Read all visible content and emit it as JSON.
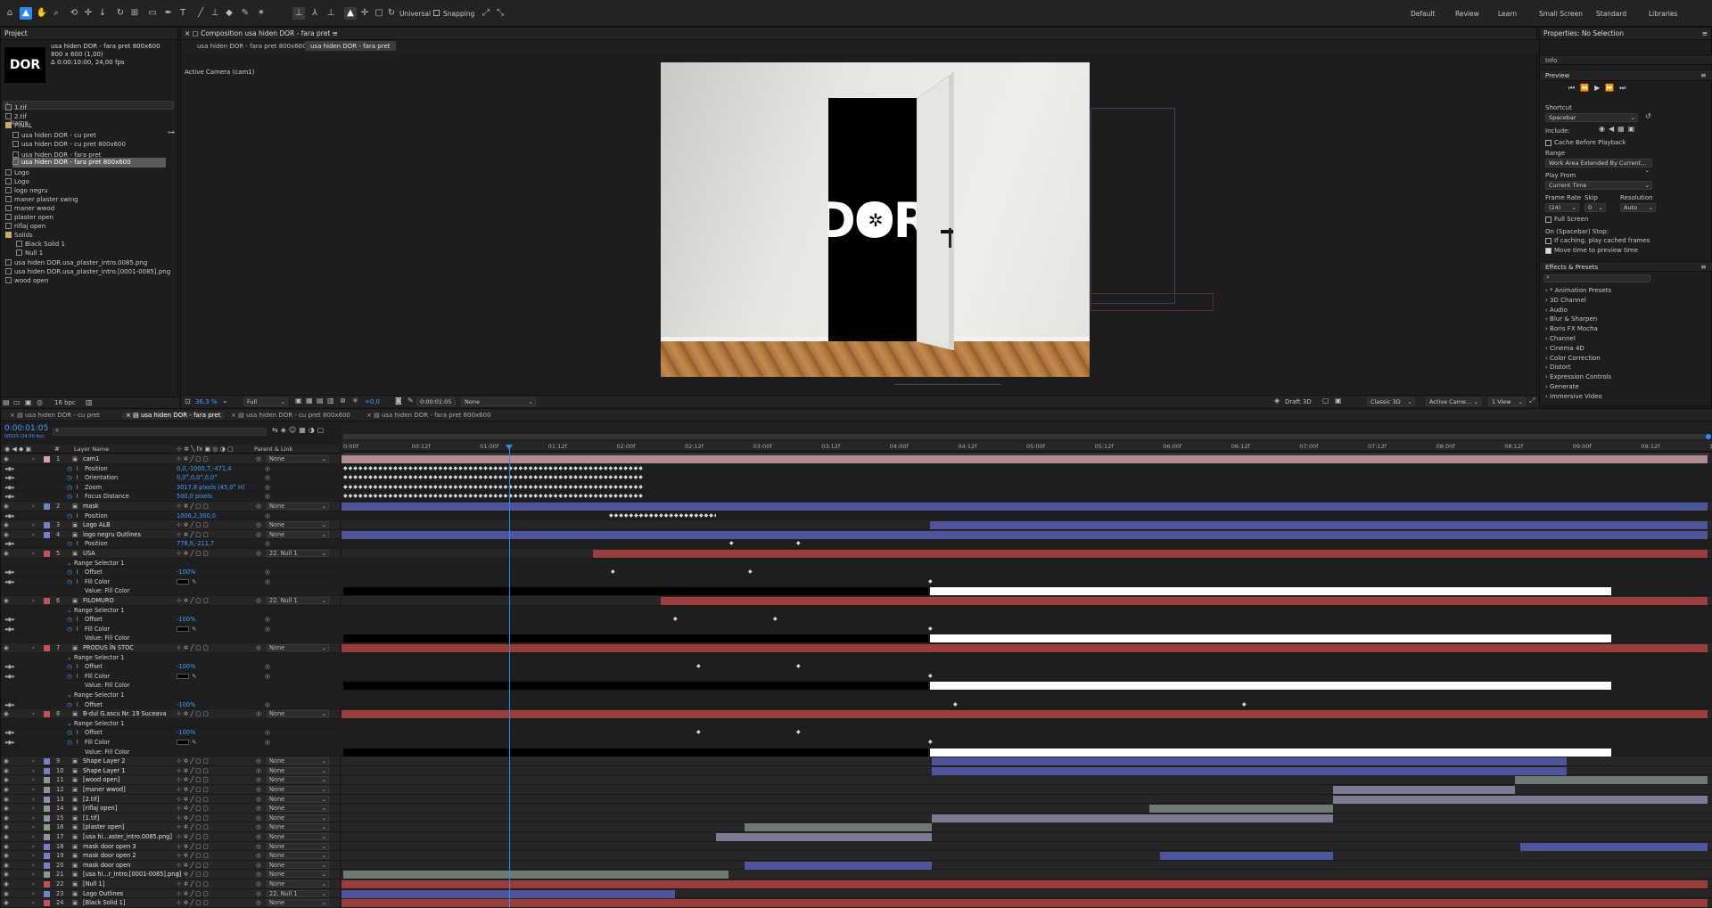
{
  "toolbar": {
    "universal_label": "Universal",
    "snapping_label": "Snapping",
    "workspaces": [
      "Default",
      "Review",
      "Learn",
      "Small Screen",
      "Standard",
      "Libraries"
    ]
  },
  "project": {
    "title": "Project",
    "item_name": "usa hiden DOR - fara pret 800x600",
    "item_size": "800 x 600 (1,00)",
    "item_duration": "Δ 0:00:10:00, 24,00 fps",
    "logo_text": "DOR",
    "name_header": "Name",
    "items": [
      {
        "label": "1.tif",
        "indent": 0
      },
      {
        "label": "2.tif",
        "indent": 0
      },
      {
        "label": "FINAL",
        "indent": 0
      },
      {
        "label": "usa hiden DOR - cu pret",
        "indent": 2
      },
      {
        "label": "usa hiden DOR - cu pret 800x600",
        "indent": 2
      },
      {
        "label": "usa hiden DOR - fara pret",
        "indent": 2
      },
      {
        "label": "usa hiden DOR - fara pret 800x600",
        "indent": 2
      },
      {
        "label": "Logo",
        "indent": 0
      },
      {
        "label": "Logo",
        "indent": 0
      },
      {
        "label": "logo negru",
        "indent": 0
      },
      {
        "label": "maner plaster swing",
        "indent": 0
      },
      {
        "label": "maner wwod",
        "indent": 0
      },
      {
        "label": "plaster open",
        "indent": 0
      },
      {
        "label": "riflaj open",
        "indent": 0
      },
      {
        "label": "Solids",
        "indent": 0
      },
      {
        "label": "Black Solid 1",
        "indent": 3
      },
      {
        "label": "Null 1",
        "indent": 3
      },
      {
        "label": "usa hiden DOR.usa_plaster_intro.0085.png",
        "indent": 0
      },
      {
        "label": "usa hiden DOR.usa_plaster_intro.[0001-0085].png",
        "indent": 0
      },
      {
        "label": "wood open",
        "indent": 0
      }
    ],
    "bpc": "16 bpc"
  },
  "composition": {
    "panel_title": "Composition usa hiden DOR - fara pret",
    "tabs": [
      "usa hiden DOR - fara pret 800x600",
      "usa hiden DOR - fara pret"
    ],
    "active_camera": "Active Camera (cam1)",
    "logo_text": "DOR",
    "footer": {
      "zoom": "36,3 %",
      "resolution": "Full",
      "exposure": "+0,0",
      "timecode": "0:00:01:05",
      "channel": "None",
      "draft": "Draft 3D",
      "renderer": "Classic 3D",
      "camera": "Active Came...",
      "view": "1 View"
    }
  },
  "properties": {
    "title": "Properties: No Selection",
    "info": "Info",
    "preview": "Preview",
    "shortcut_label": "Shortcut",
    "shortcut_value": "Spacebar",
    "include_label": "Include:",
    "cache_label": "Cache Before Playback",
    "range_label": "Range",
    "range_value": "Work Area Extended By Current...",
    "play_from_label": "Play From",
    "play_from_value": "Current Time",
    "frame_rate_label": "Frame Rate",
    "skip_label": "Skip",
    "resolution_label": "Resolution",
    "frame_rate_value": "(24)",
    "skip_value": "0",
    "resolution_value": "Auto",
    "full_screen": "Full Screen",
    "on_stop": "On (Spacebar) Stop:",
    "if_caching": "If caching, play cached frames",
    "move_time": "Move time to preview time"
  },
  "effects": {
    "title": "Effects & Presets",
    "items": [
      "* Animation Presets",
      "3D Channel",
      "Audio",
      "Blur & Sharpen",
      "Boris FX Mocha",
      "Channel",
      "Cinema 4D",
      "Color Correction",
      "Distort",
      "Expression Controls",
      "Generate",
      "Immersive Video"
    ]
  },
  "timeline": {
    "tabs": [
      "usa hiden DOR - cu pret",
      "usa hiden DOR - fara pret",
      "usa hiden DOR - cu pret 800x600",
      "usa hiden DOR - fara pret 800x600"
    ],
    "timecode": "0:00:01:05",
    "timecode_sub": "00029 (24.00 fps)",
    "col_layer_name": "Layer Name",
    "col_parent": "Parent & Link",
    "ruler": [
      "0:00f",
      "00:12f",
      "01:00f",
      "01:12f",
      "02:00f",
      "02:12f",
      "03:00f",
      "03:12f",
      "04:00f",
      "04:12f",
      "05:00f",
      "05:12f",
      "06:00f",
      "06:12f",
      "07:00f",
      "07:12f",
      "08:00f",
      "08:12f",
      "09:00f",
      "09:12f",
      "10:0"
    ],
    "rows": [
      {
        "num": "1",
        "name": "cam1",
        "parent": "None",
        "type": "layer",
        "color": "#d8a0a8"
      },
      {
        "name": "Position",
        "value": "0,0,-1000,7,-471,4",
        "type": "prop"
      },
      {
        "name": "Orientation",
        "value": "0,0°,0,0°,0,0°",
        "type": "prop"
      },
      {
        "name": "Zoom",
        "value": "3017,8 pixels (45,0° H)",
        "type": "prop"
      },
      {
        "name": "Focus Distance",
        "value": "500,0 pixels",
        "type": "prop"
      },
      {
        "num": "2",
        "name": "mask",
        "parent": "None",
        "type": "layer",
        "color": "#7680c8"
      },
      {
        "name": "Position",
        "value": "1006,2,300,0",
        "type": "prop"
      },
      {
        "num": "3",
        "name": "Logo ALB",
        "parent": "None",
        "type": "layer",
        "color": "#7680c8"
      },
      {
        "num": "4",
        "name": "logo negru Outlines",
        "parent": "None",
        "type": "layer",
        "color": "#7680c8"
      },
      {
        "name": "Position",
        "value": "778,6,-211,7",
        "type": "prop"
      },
      {
        "num": "5",
        "name": "USA",
        "parent": "22. Null 1",
        "type": "layer",
        "color": "#c85050"
      },
      {
        "name": "Range Selector 1",
        "value": "",
        "type": "group"
      },
      {
        "name": "Offset",
        "value": "-100%",
        "type": "prop"
      },
      {
        "name": "Fill Color",
        "value": "",
        "type": "prop"
      },
      {
        "name": "Value: Fill Color",
        "value": "",
        "type": "sub"
      },
      {
        "num": "6",
        "name": "FILOMURO",
        "parent": "22. Null 1",
        "type": "layer",
        "color": "#c85050"
      },
      {
        "name": "Range Selector 1",
        "value": "",
        "type": "group"
      },
      {
        "name": "Offset",
        "value": "-100%",
        "type": "prop"
      },
      {
        "name": "Fill Color",
        "value": "",
        "type": "prop"
      },
      {
        "name": "Value: Fill Color",
        "value": "",
        "type": "sub"
      },
      {
        "num": "7",
        "name": "PRODUS ÎN STOC",
        "parent": "None",
        "type": "layer",
        "color": "#c85050"
      },
      {
        "name": "Range Selector 1",
        "value": "",
        "type": "group"
      },
      {
        "name": "Offset",
        "value": "-100%",
        "type": "prop"
      },
      {
        "name": "Fill Color",
        "value": "",
        "type": "prop"
      },
      {
        "name": "Value: Fill Color",
        "value": "",
        "type": "sub"
      },
      {
        "name": "Range Selector 1",
        "value": "",
        "type": "group"
      },
      {
        "name": "Offset",
        "value": "-100%",
        "type": "prop"
      },
      {
        "num": "8",
        "name": "B-dul G.ascu Nr. 19 Suceava",
        "parent": "None",
        "type": "layer",
        "color": "#c85050"
      },
      {
        "name": "Range Selector 1",
        "value": "",
        "type": "group"
      },
      {
        "name": "Offset",
        "value": "-100%",
        "type": "prop"
      },
      {
        "name": "Fill Color",
        "value": "",
        "type": "prop"
      },
      {
        "name": "Value: Fill Color",
        "value": "",
        "type": "sub"
      },
      {
        "num": "9",
        "name": "Shape Layer 2",
        "parent": "None",
        "type": "layer",
        "color": "#7680c8"
      },
      {
        "num": "10",
        "name": "Shape Layer 1",
        "parent": "None",
        "type": "layer",
        "color": "#7680c8"
      },
      {
        "num": "11",
        "name": "[wood open]",
        "parent": "None",
        "type": "layer",
        "color": "#8a9a90"
      },
      {
        "num": "12",
        "name": "[maner wwod]",
        "parent": "None",
        "type": "layer",
        "color": "#8a9a90"
      },
      {
        "num": "13",
        "name": "[2.tif]",
        "parent": "None",
        "type": "layer",
        "color": "#9090a8"
      },
      {
        "num": "14",
        "name": "[riflaj open]",
        "parent": "None",
        "type": "layer",
        "color": "#8a9a90"
      },
      {
        "num": "15",
        "name": "[1.tif]",
        "parent": "None",
        "type": "layer",
        "color": "#9090a8"
      },
      {
        "num": "16",
        "name": "[plaster open]",
        "parent": "None",
        "type": "layer",
        "color": "#8a9a90"
      },
      {
        "num": "17",
        "name": "[usa hi...aster_intro.0085.png]",
        "parent": "None",
        "type": "layer",
        "color": "#9090a8"
      },
      {
        "num": "18",
        "name": "mask door open 3",
        "parent": "None",
        "type": "layer",
        "color": "#7680c8"
      },
      {
        "num": "19",
        "name": "mask door open 2",
        "parent": "None",
        "type": "layer",
        "color": "#7680c8"
      },
      {
        "num": "20",
        "name": "mask door open",
        "parent": "None",
        "type": "layer",
        "color": "#7680c8"
      },
      {
        "num": "21",
        "name": "[usa hi...r_Intro.[0001-0085].png]",
        "parent": "None",
        "type": "layer",
        "color": "#8a9a90"
      },
      {
        "num": "22",
        "name": "[Null 1]",
        "parent": "None",
        "type": "layer",
        "color": "#c85050"
      },
      {
        "num": "23",
        "name": "Logo Outlines",
        "parent": "22. Null 1",
        "type": "layer",
        "color": "#7680c8"
      },
      {
        "num": "24",
        "name": "[Black Solid 1]",
        "parent": "None",
        "type": "layer",
        "color": "#c85050"
      }
    ]
  },
  "colors": {
    "accent_blue": "#2d8ceb",
    "layer_red": "#9a3d3d",
    "layer_purple": "#4e559a",
    "layer_sage": "#6d7b73",
    "layer_lavender": "#7b7b93",
    "layer_pink": "#b28a90"
  }
}
